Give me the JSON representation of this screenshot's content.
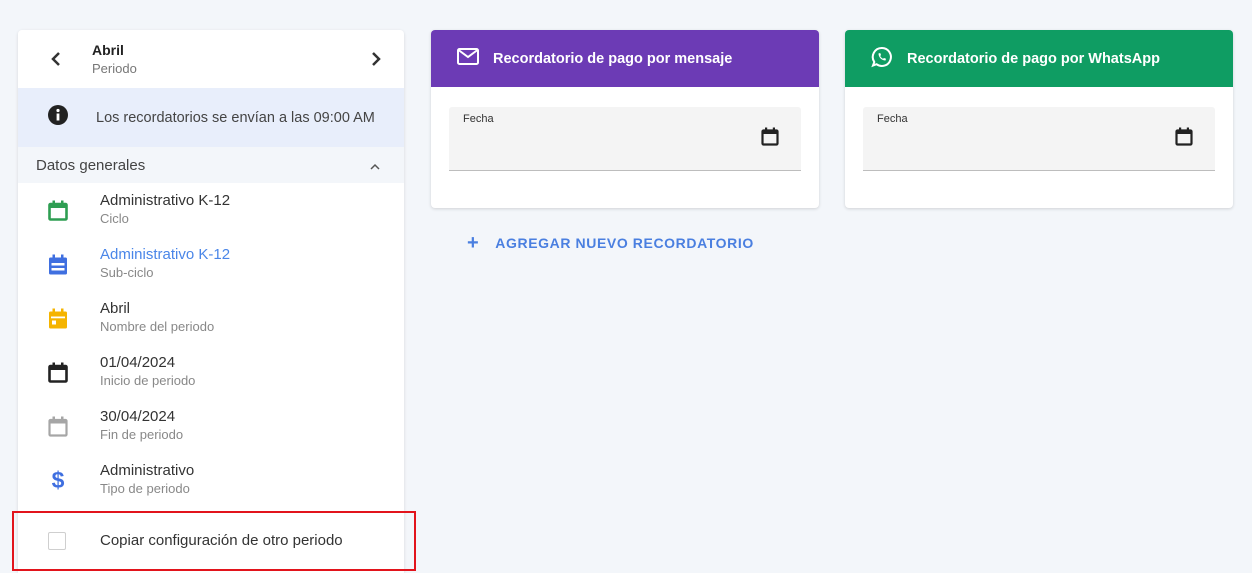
{
  "period": {
    "name": "Abril",
    "label": "Periodo"
  },
  "info": {
    "text": "Los recordatorios se envían a las 09:00 AM"
  },
  "general": {
    "title": "Datos generales",
    "items": [
      {
        "value": "Administrativo K-12",
        "label": "Ciclo",
        "icon": "calendar-icon",
        "color": "#2e9e52"
      },
      {
        "value": "Administrativo K-12",
        "label": "Sub-ciclo",
        "icon": "calendar-icon",
        "color": "#3f6fe0"
      },
      {
        "value": "Abril",
        "label": "Nombre del periodo",
        "icon": "calendar-icon",
        "color": "#f5b400"
      },
      {
        "value": "01/04/2024",
        "label": "Inicio de periodo",
        "icon": "calendar-icon",
        "color": "#222222"
      },
      {
        "value": "30/04/2024",
        "label": "Fin de periodo",
        "icon": "calendar-icon",
        "color": "#a6a6a6"
      },
      {
        "value": "Administrativo",
        "label": "Tipo de periodo",
        "icon": "dollar-icon",
        "color": "#3f6fe0"
      }
    ]
  },
  "copy": {
    "label": "Copiar configuración de otro periodo"
  },
  "cards": [
    {
      "title": "Recordatorio de pago por mensaje",
      "color": "#6c3bb5",
      "icon": "mail-icon",
      "field_label": "Fecha"
    },
    {
      "title": "Recordatorio de pago por WhatsApp",
      "color": "#0f9d63",
      "icon": "whatsapp-icon",
      "field_label": "Fecha"
    }
  ],
  "add_button": {
    "label": "AGREGAR NUEVO RECORDATORIO"
  }
}
